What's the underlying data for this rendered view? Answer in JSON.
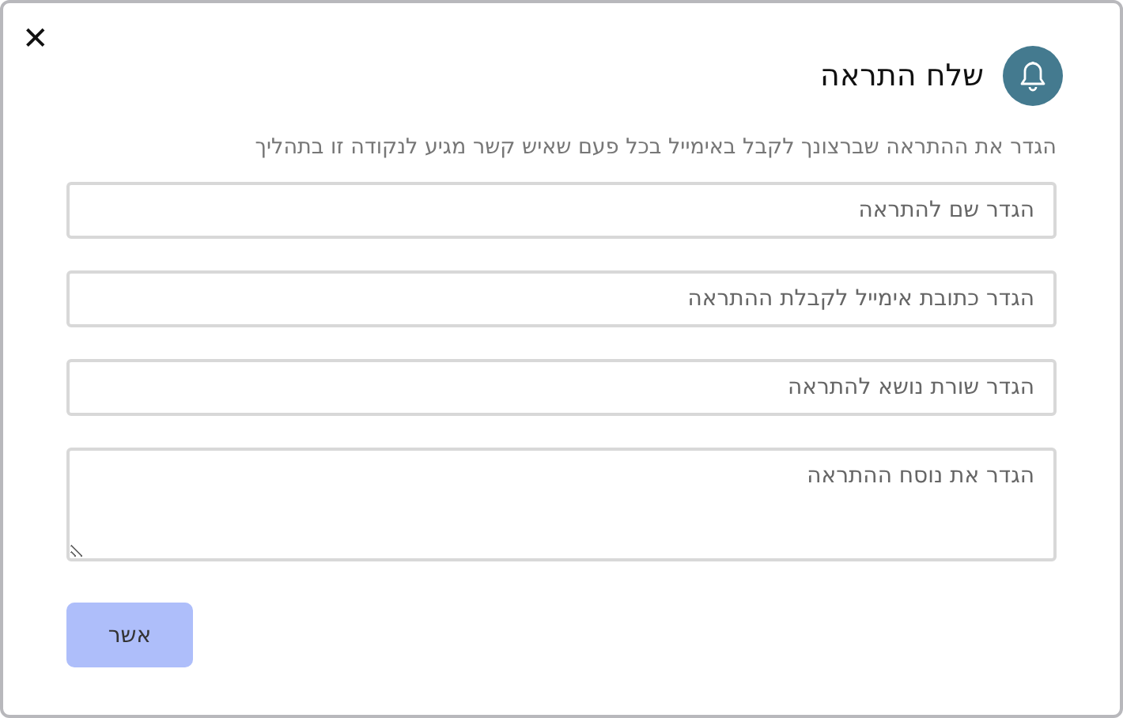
{
  "dialog": {
    "close": "✕",
    "title": "שלח התראה",
    "description": "הגדר את ההתראה שברצונך לקבל באימייל בכל פעם שאיש קשר מגיע לנקודה זו בתהליך"
  },
  "fields": [
    {
      "kind": "input",
      "placeholder": "הגדר שם להתראה"
    },
    {
      "kind": "input",
      "placeholder": "הגדר כתובת אימייל לקבלת ההתראה"
    },
    {
      "kind": "input",
      "placeholder": "הגדר שורת נושא להתראה"
    },
    {
      "kind": "textarea",
      "placeholder": "הגדר את נוסח ההתראה"
    }
  ],
  "confirm_button": {
    "label": "אשר",
    "disabled": true
  }
}
